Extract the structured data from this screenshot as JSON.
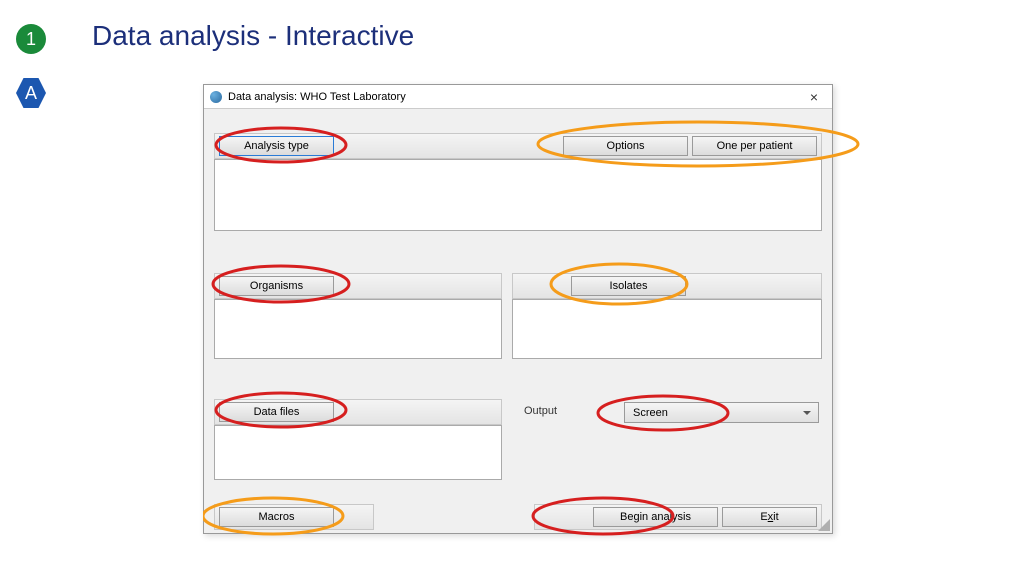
{
  "badges": {
    "step": "1",
    "letter": "A"
  },
  "page_title": "Data analysis - Interactive",
  "dialog": {
    "title": "Data analysis: WHO Test Laboratory",
    "buttons": {
      "analysis_type": "Analysis type",
      "options": "Options",
      "one_per_patient": "One per patient",
      "organisms": "Organisms",
      "isolates": "Isolates",
      "data_files": "Data files",
      "macros": "Macros",
      "begin_analysis": "Begin analysis",
      "exit": "Exit"
    },
    "labels": {
      "output": "Output"
    },
    "output_dropdown": "Screen"
  },
  "annotations": {
    "red_color": "#d61f1f",
    "orange_color": "#f59c1a"
  }
}
